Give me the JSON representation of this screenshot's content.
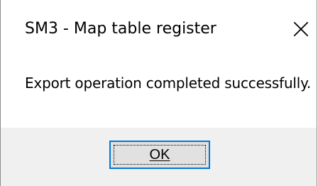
{
  "window": {
    "title": "SM3 - Map table register",
    "close_icon": "close-icon"
  },
  "message": {
    "text": "Export operation completed successfully."
  },
  "buttons": {
    "ok_label": "OK",
    "ok_accent": "#0078d7"
  }
}
